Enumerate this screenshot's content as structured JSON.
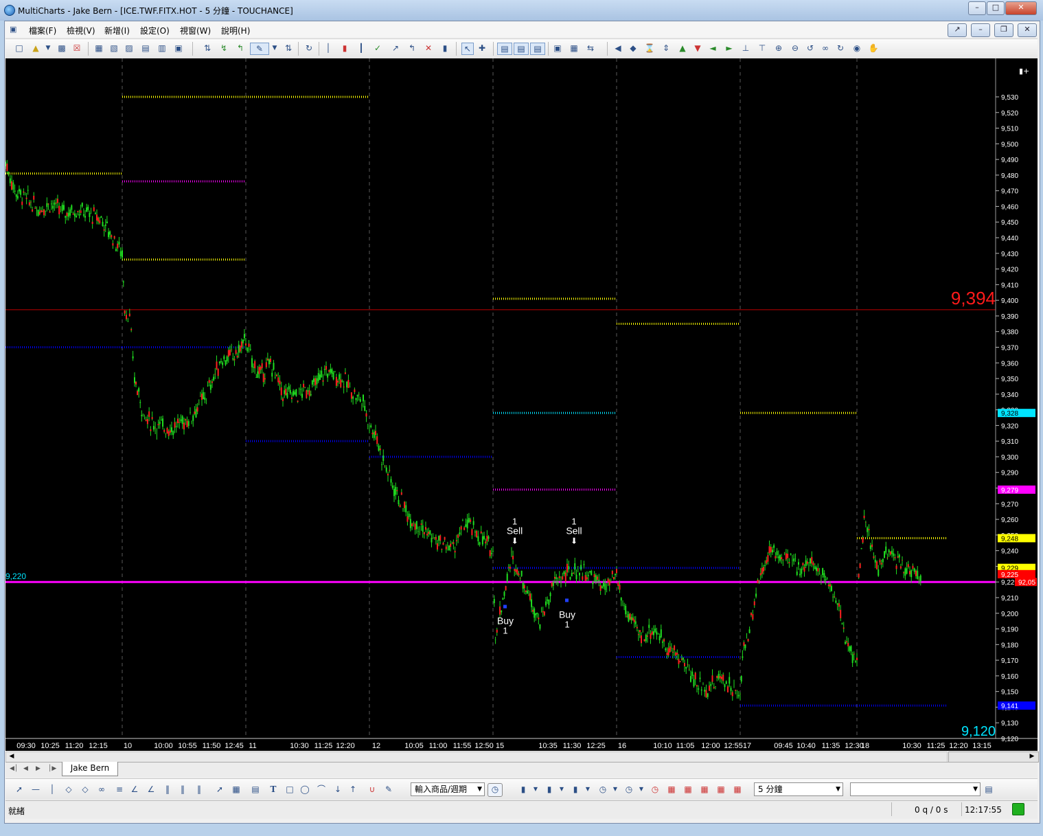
{
  "window": {
    "title": "MultiCharts - Jake Bern - [ICE.TWF.FITX.HOT - 5 分鐘 - TOUCHANCE]",
    "min_label": "0",
    "max_label": "1",
    "close_label": "r"
  },
  "menu": [
    "檔案(F)",
    "檢視(V)",
    "新增(I)",
    "設定(O)",
    "視窗(W)",
    "說明(H)"
  ],
  "chart": {
    "background": "#000000",
    "price_axis": {
      "ticks": [
        9530,
        9520,
        9510,
        9500,
        9490,
        9480,
        9470,
        9460,
        9450,
        9440,
        9430,
        9420,
        9410,
        9400,
        9390,
        9380,
        9370,
        9360,
        9350,
        9340,
        9330,
        9320,
        9310,
        9300,
        9290,
        9280,
        9270,
        9260,
        9250,
        9240,
        9230,
        9220,
        9210,
        9200,
        9190,
        9180,
        9170,
        9160,
        9150,
        9140,
        9130,
        9120
      ],
      "tick_labels": [
        "9,530",
        "9,520",
        "9,510",
        "9,500",
        "9,490",
        "9,480",
        "9,470",
        "9,460",
        "9,450",
        "9,440",
        "9,430",
        "9,420",
        "9,410",
        "9,400",
        "9,390",
        "9,380",
        "9,370",
        "9,360",
        "9,350",
        "9,340",
        "9,330",
        "9,320",
        "9,310",
        "9,300",
        "9,290",
        "9,280",
        "9,270",
        "9,260",
        "9,250",
        "9,240",
        "9,230",
        "9,220",
        "9,210",
        "9,200",
        "9,190",
        "9,180",
        "9,170",
        "9,160",
        "9,150",
        "9,140",
        "9,130",
        "9,120"
      ],
      "top_label": "9,394",
      "top_label_color": "#ff1a1a",
      "bottom_label": "9,120",
      "bottom_label_color": "#00e5ff",
      "markers": [
        {
          "label": "9,328",
          "bg": "#00e5ff"
        },
        {
          "label": "9,279",
          "bg": "#ff00ff"
        },
        {
          "label": "9,248",
          "bg": "#ffff00"
        },
        {
          "label": "9,229",
          "bg": "#ffff00"
        },
        {
          "label": "9,225",
          "bg": "#ff0000"
        },
        {
          "label": "92,05",
          "bg": "#ff0000"
        },
        {
          "label": "9,141",
          "bg": "#0000ff"
        }
      ]
    },
    "time_axis": [
      "09:30",
      "10:25",
      "11:20",
      "12:15",
      "10",
      "10:00",
      "10:55",
      "11:50",
      "12:45",
      "11",
      "10:30",
      "11:25",
      "12:20",
      "12",
      "10:05",
      "11:00",
      "11:55",
      "12:50",
      "15",
      "10:35",
      "11:30",
      "12:25",
      "16",
      "10:10",
      "11:05",
      "12:00",
      "12:55",
      "17",
      "09:45",
      "10:40",
      "11:35",
      "12:30",
      "18",
      "10:30",
      "11:25",
      "12:20",
      "13:15"
    ],
    "day_labels": [
      "10",
      "11",
      "12",
      "15",
      "16",
      "17",
      "18"
    ],
    "hline_9394": {
      "value": 9394,
      "color": "#c00000"
    },
    "hline_9220": {
      "value": 9220,
      "label": "9,220",
      "color": "#ff00ff",
      "label_color": "#00e5ff"
    },
    "levels": [
      {
        "day": 0,
        "value": 9481,
        "color": "#ffff00"
      },
      {
        "day": 1,
        "value": 9530,
        "color": "#ffff00"
      },
      {
        "day": 1,
        "value": 9476,
        "color": "#ff00ff"
      },
      {
        "day": 1,
        "value": 9426,
        "color": "#ffff00"
      },
      {
        "day": 0,
        "value": 9370,
        "color": "#0000ff"
      },
      {
        "day": 1,
        "value": 9370,
        "color": "#0000ff"
      },
      {
        "day": 2,
        "value": 9530,
        "color": "#ffff00"
      },
      {
        "day": 2,
        "value": 9310,
        "color": "#0000ff"
      },
      {
        "day": 3,
        "value": 9300,
        "color": "#0000ff"
      },
      {
        "day": 4,
        "value": 9401,
        "color": "#ffff00"
      },
      {
        "day": 4,
        "value": 9328,
        "color": "#00e5ff"
      },
      {
        "day": 4,
        "value": 9279,
        "color": "#ff00ff"
      },
      {
        "day": 4,
        "value": 9229,
        "color": "#0000ff"
      },
      {
        "day": 5,
        "value": 9385,
        "color": "#ffff00"
      },
      {
        "day": 5,
        "value": 9229,
        "color": "#0000ff"
      },
      {
        "day": 5,
        "value": 9172,
        "color": "#0000ff"
      },
      {
        "day": 6,
        "value": 9328,
        "color": "#ffff00"
      },
      {
        "day": 6,
        "value": 9141,
        "color": "#0000ff"
      },
      {
        "day": 7,
        "value": 9248,
        "color": "#ffff00"
      },
      {
        "day": 7,
        "value": 9141,
        "color": "#0000ff"
      }
    ],
    "signals": [
      {
        "text": "Sell",
        "qty": "1",
        "color": "#ffffff"
      },
      {
        "text": "Buy",
        "qty": "1",
        "color": "#ffffff"
      },
      {
        "text": "Sell",
        "qty": "1",
        "color": "#ffffff"
      },
      {
        "text": "Buy",
        "qty": "1",
        "color": "#ffffff"
      }
    ],
    "price_path": [
      [
        0,
        9488
      ],
      [
        0.08,
        9470
      ],
      [
        0.18,
        9465
      ],
      [
        0.28,
        9458
      ],
      [
        0.38,
        9462
      ],
      [
        0.5,
        9456
      ],
      [
        0.62,
        9458
      ],
      [
        0.72,
        9455
      ],
      [
        0.82,
        9452
      ],
      [
        0.92,
        9440
      ],
      [
        1.0,
        9430
      ],
      [
        1.02,
        9395
      ],
      [
        1.06,
        9388
      ],
      [
        1.1,
        9350
      ],
      [
        1.18,
        9325
      ],
      [
        1.28,
        9320
      ],
      [
        1.4,
        9318
      ],
      [
        1.55,
        9325
      ],
      [
        1.68,
        9340
      ],
      [
        1.8,
        9362
      ],
      [
        1.92,
        9365
      ],
      [
        2.0,
        9375
      ],
      [
        2.05,
        9360
      ],
      [
        2.12,
        9352
      ],
      [
        2.2,
        9360
      ],
      [
        2.3,
        9340
      ],
      [
        2.42,
        9340
      ],
      [
        2.55,
        9345
      ],
      [
        2.65,
        9355
      ],
      [
        2.78,
        9350
      ],
      [
        2.88,
        9340
      ],
      [
        2.95,
        9335
      ],
      [
        3.0,
        9320
      ],
      [
        3.05,
        9315
      ],
      [
        3.1,
        9300
      ],
      [
        3.2,
        9280
      ],
      [
        3.32,
        9262
      ],
      [
        3.42,
        9255
      ],
      [
        3.55,
        9245
      ],
      [
        3.68,
        9242
      ],
      [
        3.78,
        9258
      ],
      [
        3.88,
        9250
      ],
      [
        4.0,
        9240
      ],
      [
        4.02,
        9185
      ],
      [
        4.08,
        9210
      ],
      [
        4.15,
        9235
      ],
      [
        4.22,
        9225
      ],
      [
        4.3,
        9210
      ],
      [
        4.38,
        9195
      ],
      [
        4.5,
        9220
      ],
      [
        4.6,
        9225
      ],
      [
        4.7,
        9228
      ],
      [
        4.82,
        9222
      ],
      [
        4.92,
        9215
      ],
      [
        5.0,
        9225
      ],
      [
        5.05,
        9205
      ],
      [
        5.12,
        9195
      ],
      [
        5.2,
        9185
      ],
      [
        5.3,
        9190
      ],
      [
        5.42,
        9178
      ],
      [
        5.55,
        9168
      ],
      [
        5.65,
        9155
      ],
      [
        5.75,
        9152
      ],
      [
        5.85,
        9160
      ],
      [
        5.95,
        9150
      ],
      [
        6.0,
        9145
      ],
      [
        6.02,
        9175
      ],
      [
        6.08,
        9190
      ],
      [
        6.15,
        9220
      ],
      [
        6.25,
        9240
      ],
      [
        6.38,
        9235
      ],
      [
        6.5,
        9230
      ],
      [
        6.6,
        9232
      ],
      [
        6.72,
        9225
      ],
      [
        6.82,
        9210
      ],
      [
        6.9,
        9185
      ],
      [
        6.95,
        9175
      ],
      [
        7.0,
        9172
      ],
      [
        7.02,
        9222
      ],
      [
        7.08,
        9258
      ],
      [
        7.15,
        9245
      ],
      [
        7.22,
        9228
      ],
      [
        7.32,
        9238
      ],
      [
        7.42,
        9235
      ],
      [
        7.5,
        9230
      ],
      [
        7.6,
        9228
      ],
      [
        7.72,
        9222
      ]
    ]
  },
  "tabs": [
    "Jake Bern"
  ],
  "toolbar2": {
    "symbol_combo": "輸入商品/週期",
    "interval_combo": "5 分鐘",
    "empty_combo": ""
  },
  "status": {
    "left": "就緒",
    "orders": "0 q / 0 s",
    "clock": "12:17:55"
  }
}
